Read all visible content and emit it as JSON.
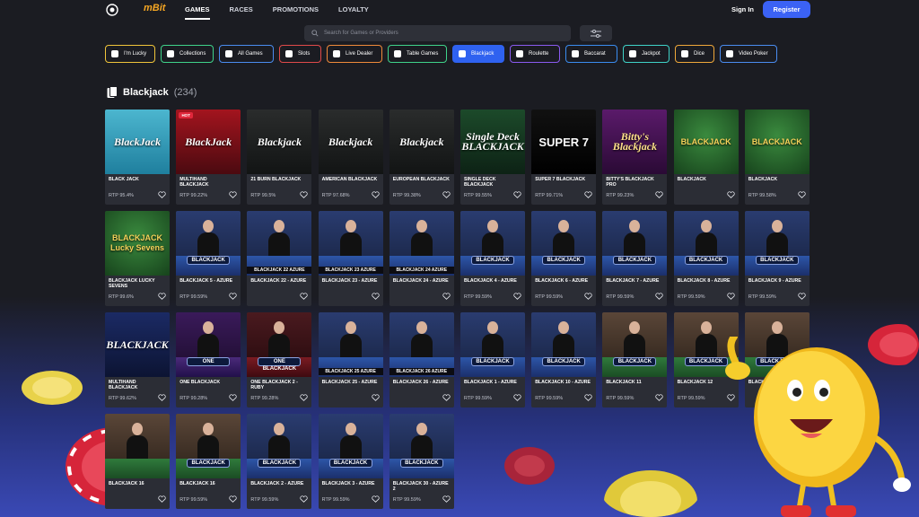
{
  "header": {
    "logo_text": "mBit",
    "nav": [
      {
        "label": "GAMES",
        "active": true
      },
      {
        "label": "RACES",
        "active": false
      },
      {
        "label": "PROMOTIONS",
        "active": false
      },
      {
        "label": "LOYALTY",
        "active": false
      }
    ],
    "signin_label": "Sign In",
    "register_label": "Register"
  },
  "search": {
    "placeholder": "Search for Games or Providers"
  },
  "categories": [
    {
      "label": "I'm Lucky",
      "color": "#f0c43a"
    },
    {
      "label": "Collections",
      "color": "#3fd38a"
    },
    {
      "label": "All Games",
      "color": "#4a8cf0"
    },
    {
      "label": "Slots",
      "color": "#e04a4a"
    },
    {
      "label": "Live Dealer",
      "color": "#f08a3a"
    },
    {
      "label": "Table Games",
      "color": "#3fd38a"
    },
    {
      "label": "Blackjack",
      "color": "#2f62f0",
      "active": true
    },
    {
      "label": "Roulette",
      "color": "#8a5af0"
    },
    {
      "label": "Baccarat",
      "color": "#3a8cf0"
    },
    {
      "label": "Jackpot",
      "color": "#3fd3c8"
    },
    {
      "label": "Dice",
      "color": "#f0a83a"
    },
    {
      "label": "Video Poker",
      "color": "#4a8cf0"
    }
  ],
  "section": {
    "title": "Blackjack",
    "count": "(234)"
  },
  "games": [
    {
      "title": "BLACK JACK",
      "rtp": "RTP 95.4%",
      "thumb": "BlackJack",
      "style": "teal"
    },
    {
      "title": "MULTIHAND BLACKJACK",
      "rtp": "RTP 99.22%",
      "thumb": "BlackJack",
      "style": "red",
      "hot": "HOT"
    },
    {
      "title": "21 BURN BLACKJACK",
      "rtp": "RTP 99.5%",
      "thumb": "Blackjack",
      "style": "dark"
    },
    {
      "title": "AMERICAN BLACKJACK",
      "rtp": "RTP 97.68%",
      "thumb": "Blackjack",
      "style": "dark"
    },
    {
      "title": "EUROPEAN BLACKJACK",
      "rtp": "RTP 99.38%",
      "thumb": "Blackjack",
      "style": "dark"
    },
    {
      "title": "SINGLE DECK BLACKJACK",
      "rtp": "RTP 99.55%",
      "thumb": "Single Deck BLACKJACK",
      "style": "green"
    },
    {
      "title": "SUPER 7 BLACKJACK",
      "rtp": "RTP 99.71%",
      "thumb": "SUPER 7",
      "style": "black"
    },
    {
      "title": "BITTY'S BLACKJACK PRO",
      "rtp": "RTP 99.23%",
      "thumb": "Bitty's Blackjack",
      "style": "purple"
    },
    {
      "title": "BLACKJACK",
      "rtp": "",
      "thumb": "BLACKJACK",
      "style": "felt"
    },
    {
      "title": "BLACKJACK",
      "rtp": "RTP 99.58%",
      "thumb": "BLACKJACK",
      "style": "felt"
    },
    {
      "title": "BLACKJACK LUCKY SEVENS",
      "rtp": "RTP 99.6%",
      "thumb": "BLACKJACK Lucky Sevens",
      "style": "felt"
    },
    {
      "title": "BLACKJACK 5 - AZURE",
      "rtp": "RTP 99.59%",
      "live": true,
      "badge": "BLACKJACK"
    },
    {
      "title": "BLACKJACK 22 - AZURE",
      "rtp": "",
      "live": true,
      "strip": "BLACKJACK 22 AZURE"
    },
    {
      "title": "BLACKJACK 23 - AZURE",
      "rtp": "",
      "live": true,
      "strip": "BLACKJACK 23 AZURE"
    },
    {
      "title": "BLACKJACK 24 - AZURE",
      "rtp": "",
      "live": true,
      "strip": "BLACKJACK 24 AZURE"
    },
    {
      "title": "BLACKJACK 4 - AZURE",
      "rtp": "RTP 99.59%",
      "live": true,
      "badge": "BLACKJACK"
    },
    {
      "title": "BLACKJACK 6 - AZURE",
      "rtp": "RTP 99.59%",
      "live": true,
      "badge": "BLACKJACK"
    },
    {
      "title": "BLACKJACK 7 - AZURE",
      "rtp": "RTP 99.59%",
      "live": true,
      "badge": "BLACKJACK"
    },
    {
      "title": "BLACKJACK 8 - AZURE",
      "rtp": "RTP 99.59%",
      "live": true,
      "badge": "BLACKJACK"
    },
    {
      "title": "BLACKJACK 9 - AZURE",
      "rtp": "RTP 99.59%",
      "live": true,
      "badge": "BLACKJACK"
    },
    {
      "title": "MULTIHAND BLACKJACK",
      "rtp": "RTP 99.62%",
      "thumb": "BLACKJACK",
      "style": "blue"
    },
    {
      "title": "ONE BLACKJACK",
      "rtp": "RTP 99.28%",
      "live": true,
      "badge": "ONE",
      "table": "purple"
    },
    {
      "title": "ONE BLACKJACK 2 - RUBY",
      "rtp": "RTP 99.28%",
      "live": true,
      "badge": "ONE BLACKJACK",
      "table": "ruby"
    },
    {
      "title": "BLACKJACK 25 - AZURE",
      "rtp": "",
      "live": true,
      "strip": "BLACKJACK 25 AZURE"
    },
    {
      "title": "BLACKJACK 26 - AZURE",
      "rtp": "",
      "live": true,
      "strip": "BLACKJACK 26 AZURE"
    },
    {
      "title": "BLACKJACK 1 - AZURE",
      "rtp": "RTP 99.59%",
      "live": true,
      "badge": "BLACKJACK"
    },
    {
      "title": "BLACKJACK 10 - AZURE",
      "rtp": "RTP 99.59%",
      "live": true,
      "badge": "BLACKJACK"
    },
    {
      "title": "BLACKJACK 11",
      "rtp": "RTP 99.59%",
      "live": true,
      "badge": "BLACKJACK",
      "table": "green"
    },
    {
      "title": "BLACKJACK 12",
      "rtp": "RTP 99.59%",
      "live": true,
      "badge": "BLACKJACK",
      "table": "green"
    },
    {
      "title": "BLACKJACK",
      "rtp": "",
      "live": true,
      "badge": "BLACKJACK",
      "table": "green"
    },
    {
      "title": "BLACKJACK 16",
      "rtp": "",
      "live": true,
      "badge": "",
      "table": "green"
    },
    {
      "title": "BLACKJACK 16",
      "rtp": "RTP 99.59%",
      "live": true,
      "badge": "BLACKJACK",
      "table": "green"
    },
    {
      "title": "BLACKJACK 2 - AZURE",
      "rtp": "RTP 99.59%",
      "live": true,
      "badge": "BLACKJACK"
    },
    {
      "title": "BLACKJACK 3 - AZURE",
      "rtp": "RTP 99.59%",
      "live": true,
      "badge": "BLACKJACK"
    },
    {
      "title": "BLACKJACK 30 - AZURE 2",
      "rtp": "RTP 99.59%",
      "live": true,
      "badge": "BLACKJACK"
    }
  ]
}
